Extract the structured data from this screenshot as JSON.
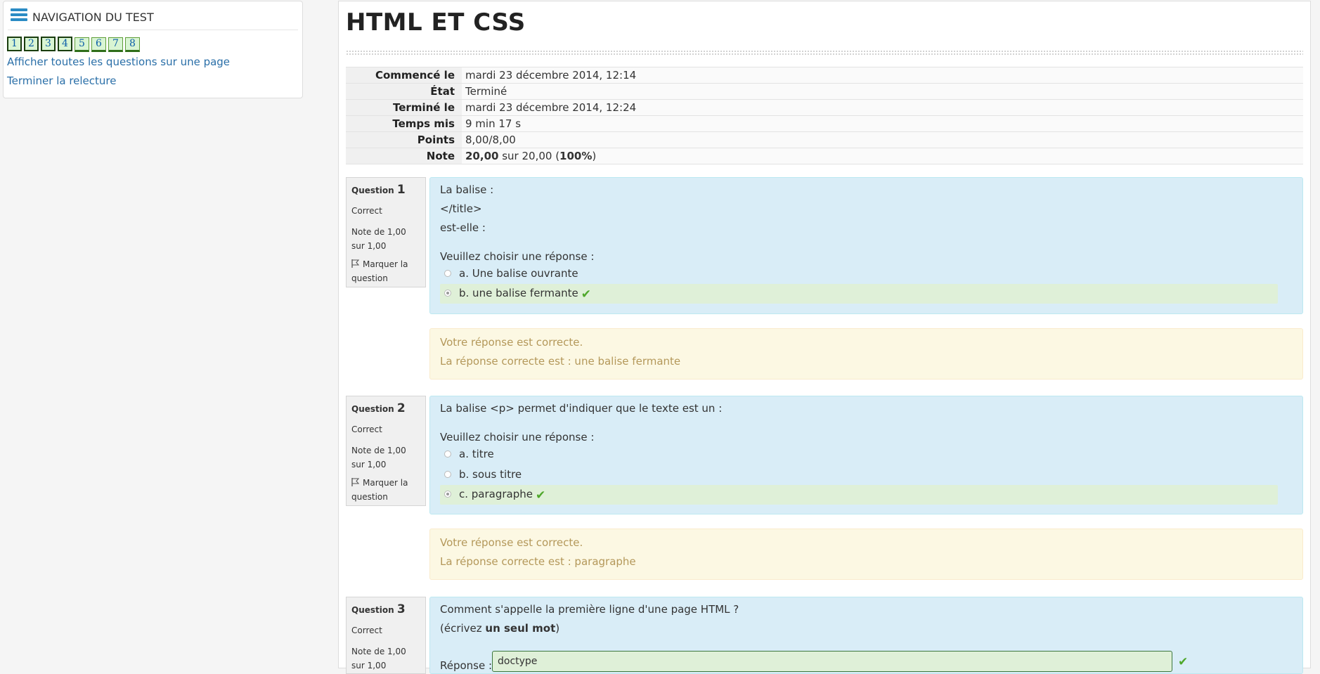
{
  "nav": {
    "title": "NAVIGATION DU TEST",
    "buttons": [
      "1",
      "2",
      "3",
      "4",
      "5",
      "6",
      "7",
      "8"
    ],
    "show_all_link": "Afficher toutes les questions sur une page",
    "finish_link": "Terminer la relecture"
  },
  "page": {
    "title": "HTML ET CSS"
  },
  "summary": {
    "rows": [
      {
        "label": "Commencé le",
        "value": "mardi 23 décembre 2014, 12:14"
      },
      {
        "label": "État",
        "value": "Terminé"
      },
      {
        "label": "Terminé le",
        "value": "mardi 23 décembre 2014, 12:24"
      },
      {
        "label": "Temps mis",
        "value": "9 min 17 s"
      },
      {
        "label": "Points",
        "value": "8,00/8,00"
      }
    ],
    "note_label": "Note",
    "note_grade": "20,00",
    "note_mid": " sur 20,00 (",
    "note_pct": "100%",
    "note_end": ")"
  },
  "common": {
    "question_word": "Question",
    "status": "Correct",
    "mark_text": "Note de 1,00 sur 1,00",
    "flag_text": "Marquer la question",
    "choose_prompt": "Veuillez choisir une réponse :",
    "feedback": "Votre réponse est correcte.",
    "tick": "✔"
  },
  "questions": [
    {
      "number": "1",
      "text_lines": [
        "La balise :",
        "</title>",
        "est-elle :"
      ],
      "options": [
        "a. Une balise ouvrante",
        "b. une balise fermante"
      ],
      "right_answer": "La réponse correcte est : une balise fermante"
    },
    {
      "number": "2",
      "text_lines": [
        "La balise <p> permet d'indiquer que le texte est un :"
      ],
      "options": [
        "a. titre",
        "b. sous titre",
        "c. paragraphe"
      ],
      "right_answer": "La réponse correcte est : paragraphe"
    },
    {
      "number": "3",
      "text_line1": "Comment s'appelle la première ligne d'une page HTML ?",
      "text_line2_pre": "(écrivez ",
      "text_line2_bold": "un seul mot",
      "text_line2_post": ")",
      "answer_label": "Réponse :",
      "answer_value": "doctype"
    }
  ],
  "colors": {
    "link": "#2a6fa8",
    "formulation_bg": "#d9edf7",
    "correct_bg": "#dff0d8",
    "outcome_bg": "#fcf8e3",
    "outcome_text": "#b4985a",
    "tick": "#4fa82b"
  },
  "icons": [
    "hamburger-icon",
    "flag-icon",
    "radio-icon",
    "check-icon"
  ]
}
